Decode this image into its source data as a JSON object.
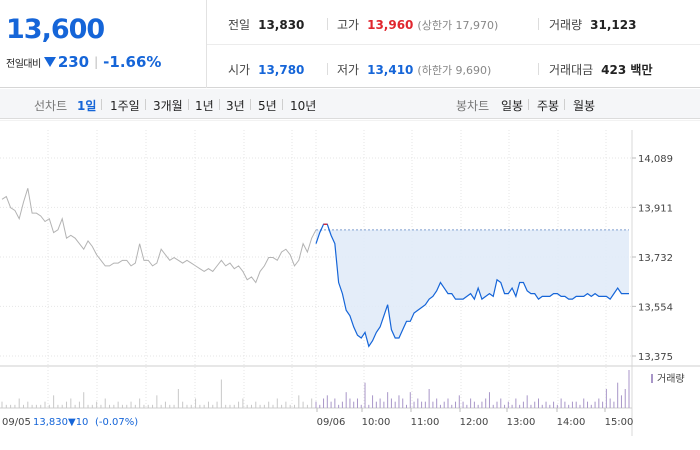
{
  "quote": {
    "price": "13,600",
    "change_label": "전일대비",
    "change": "230",
    "change_pct": "-1.66%",
    "prev_close_label": "전일",
    "prev_close": "13,830",
    "open_label": "시가",
    "open": "13,780",
    "high_label": "고가",
    "high": "13,960",
    "upper_limit": "(상한가 17,970)",
    "low_label": "저가",
    "low": "13,410",
    "lower_limit": "(하한가 9,690)",
    "volume_label": "거래량",
    "volume": "31,123",
    "amount_label": "거래대금",
    "amount": "423 백만"
  },
  "line_periods": {
    "label": "선차트",
    "items": [
      "1일",
      "1주일",
      "3개월",
      "1년",
      "3년",
      "5년",
      "10년"
    ],
    "active": "1일"
  },
  "candle_periods": {
    "label": "봉차트",
    "items": [
      "일봉",
      "주봉",
      "월봉"
    ]
  },
  "colors": {
    "up": "#e0262e",
    "down": "#1565d8",
    "prev_day_line": "#b3b3b3",
    "fill": "#dfeaf8",
    "volume": "#a896c8"
  },
  "chart_data": {
    "type": "line",
    "yticks": [
      "14,089",
      "13,911",
      "13,732",
      "13,554",
      "13,375"
    ],
    "ylim": [
      13375,
      14089
    ],
    "xticks": [
      "09/06",
      "10:00",
      "11:00",
      "12:00",
      "13:00",
      "14:00",
      "15:00"
    ],
    "prev_day": {
      "date": "09/05",
      "close": "13,830",
      "change": "10",
      "change_pct": "(-0.07%)",
      "values": [
        13940,
        13950,
        13910,
        13900,
        13870,
        13930,
        13980,
        13890,
        13890,
        13880,
        13860,
        13870,
        13820,
        13830,
        13870,
        13800,
        13810,
        13800,
        13780,
        13760,
        13790,
        13770,
        13740,
        13720,
        13700,
        13700,
        13710,
        13710,
        13720,
        13720,
        13700,
        13710,
        13780,
        13720,
        13720,
        13700,
        13710,
        13760,
        13740,
        13720,
        13730,
        13720,
        13710,
        13720,
        13710,
        13700,
        13690,
        13680,
        13690,
        13680,
        13700,
        13720,
        13700,
        13710,
        13690,
        13700,
        13680,
        13650,
        13660,
        13640,
        13680,
        13700,
        13730,
        13730,
        13720,
        13750,
        13760,
        13740,
        13700,
        13720,
        13780,
        13750,
        13800,
        13830
      ]
    },
    "today": {
      "open": 13780,
      "high": 13960,
      "low": 13410,
      "values": [
        13780,
        13820,
        13850,
        13850,
        13810,
        13780,
        13640,
        13600,
        13540,
        13520,
        13480,
        13450,
        13440,
        13460,
        13410,
        13430,
        13460,
        13480,
        13520,
        13560,
        13470,
        13440,
        13440,
        13470,
        13500,
        13500,
        13530,
        13540,
        13550,
        13560,
        13580,
        13590,
        13610,
        13640,
        13620,
        13600,
        13600,
        13580,
        13580,
        13580,
        13590,
        13600,
        13580,
        13620,
        13580,
        13590,
        13600,
        13590,
        13650,
        13640,
        13600,
        13600,
        13620,
        13590,
        13640,
        13640,
        13610,
        13600,
        13600,
        13580,
        13590,
        13590,
        13590,
        13600,
        13600,
        13590,
        13590,
        13580,
        13580,
        13590,
        13590,
        13590,
        13600,
        13590,
        13600,
        13590,
        13590,
        13590,
        13580,
        13600,
        13620,
        13600,
        13600,
        13600
      ]
    },
    "volume_legend": "거래량",
    "volume_prev": [
      2,
      1,
      1,
      1,
      3,
      1,
      2,
      1,
      1,
      1,
      2,
      1,
      4,
      1,
      1,
      2,
      3,
      1,
      2,
      5,
      1,
      1,
      2,
      1,
      3,
      1,
      1,
      2,
      1,
      1,
      2,
      1,
      3,
      1,
      1,
      1,
      4,
      1,
      2,
      1,
      1,
      6,
      2,
      1,
      1,
      3,
      1,
      1,
      2,
      1,
      2,
      9,
      1,
      1,
      1,
      2,
      3,
      1,
      1,
      2,
      1,
      1,
      2,
      1,
      3,
      1,
      2,
      1,
      1,
      4,
      2,
      1,
      3,
      2
    ],
    "volume_today": [
      2,
      1,
      3,
      4,
      2,
      3,
      1,
      2,
      5,
      3,
      2,
      3,
      1,
      8,
      1,
      4,
      2,
      3,
      2,
      5,
      3,
      2,
      4,
      3,
      1,
      5,
      2,
      3,
      2,
      2,
      6,
      2,
      3,
      1,
      2,
      3,
      1,
      2,
      4,
      2,
      1,
      3,
      2,
      1,
      2,
      3,
      5,
      1,
      2,
      3,
      1,
      2,
      1,
      3,
      1,
      2,
      4,
      1,
      2,
      3,
      1,
      2,
      1,
      2,
      1,
      3,
      2,
      1,
      2,
      2,
      1,
      3,
      2,
      1,
      2,
      3,
      2,
      6,
      3,
      2,
      8,
      4,
      6,
      12
    ]
  }
}
